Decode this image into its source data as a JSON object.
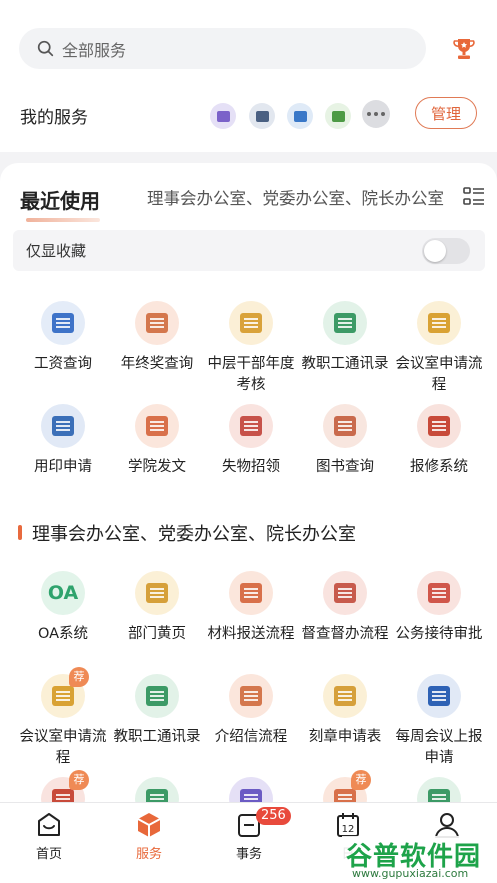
{
  "search": {
    "placeholder": "全部服务",
    "icon": "search-icon"
  },
  "header": {
    "trophy_icon": "trophy-icon"
  },
  "my_services": {
    "title": "我的服务",
    "manage_label": "管理",
    "mini_icons": [
      {
        "name": "id-card-icon",
        "bg": "#e5e0f6",
        "fg": "#7b62c9"
      },
      {
        "name": "chart-board-icon",
        "bg": "#e2e7ef",
        "fg": "#4a6082"
      },
      {
        "name": "monitor-icon",
        "bg": "#dfeaf7",
        "fg": "#3a78c8"
      },
      {
        "name": "clipboard-icon",
        "bg": "#e7f3e4",
        "fg": "#4d9a45"
      }
    ],
    "more_icon": "more-dots-icon"
  },
  "recent": {
    "title": "最近使用",
    "tab_other": "理事会办公室、党委办公室、院长办公室",
    "list_icon": "list-view-icon",
    "fav_only_label": "仅显收藏",
    "fav_only_on": false,
    "items": [
      {
        "label": "工资查询",
        "icon": "payroll-icon",
        "bg": "#e4ecf8",
        "fg": "#3e73c8"
      },
      {
        "label": "年终奖查询",
        "icon": "bonus-yen-icon",
        "bg": "#fbe6dc",
        "fg": "#d4774d"
      },
      {
        "label": "中层干部年度考核",
        "icon": "assessment-icon",
        "bg": "#fbefd6",
        "fg": "#d9a23a"
      },
      {
        "label": "教职工通讯录",
        "icon": "contacts-book-icon",
        "bg": "#e2f2e8",
        "fg": "#3c9a66"
      },
      {
        "label": "会议室申请流程",
        "icon": "meeting-room-icon",
        "bg": "#fbf0d6",
        "fg": "#d9a234"
      },
      {
        "label": "用印申请",
        "icon": "stamp-icon",
        "bg": "#e1e9f6",
        "fg": "#3b6fb8"
      },
      {
        "label": "学院发文",
        "icon": "document-icon",
        "bg": "#fbe6dc",
        "fg": "#d9704a"
      },
      {
        "label": "失物招领",
        "icon": "lost-found-icon",
        "bg": "#f9e3df",
        "fg": "#c7524a"
      },
      {
        "label": "图书查询",
        "icon": "book-search-icon",
        "bg": "#f8e6df",
        "fg": "#c96a4c"
      },
      {
        "label": "报修系统",
        "icon": "repair-house-icon",
        "bg": "#f8e2dd",
        "fg": "#c84a3a"
      }
    ]
  },
  "section": {
    "title": "理事会办公室、党委办公室、院长办公室",
    "items": [
      {
        "label": "OA系统",
        "icon": "oa-icon",
        "text": "OA",
        "bg": "#e2f4ea",
        "fg": "#2fa36d"
      },
      {
        "label": "部门黄页",
        "icon": "yellow-pages-icon",
        "bg": "#fbf0d6",
        "fg": "#d6a03a"
      },
      {
        "label": "材料报送流程",
        "icon": "folder-submit-icon",
        "bg": "#fbe6dc",
        "fg": "#d8704a"
      },
      {
        "label": "督查督办流程",
        "icon": "supervise-icon",
        "bg": "#f9e3df",
        "fg": "#c85a4c"
      },
      {
        "label": "公务接待审批",
        "icon": "reception-calendar-icon",
        "bg": "#f9e3df",
        "fg": "#d0564a"
      },
      {
        "label": "会议室申请流程",
        "icon": "meeting-room-icon",
        "bg": "#fbf0d6",
        "fg": "#d9a234",
        "badge": "荐"
      },
      {
        "label": "教职工通讯录",
        "icon": "contacts-book-icon",
        "bg": "#e2f2e8",
        "fg": "#3c9a66"
      },
      {
        "label": "介绍信流程",
        "icon": "letter-icon",
        "bg": "#fbe6dc",
        "fg": "#d4774d"
      },
      {
        "label": "刻章申请表",
        "icon": "seal-form-icon",
        "bg": "#fbf0d6",
        "fg": "#d6a03a"
      },
      {
        "label": "每周会议上报申请",
        "icon": "weekly-report-icon",
        "bg": "#e1e9f6",
        "fg": "#2e62b5"
      }
    ],
    "partial_items": [
      {
        "icon": "briefcase-icon",
        "bg": "#f9e3df",
        "fg": "#c84a3a",
        "badge": "荐"
      },
      {
        "icon": "speaker-icon",
        "bg": "#e2f2e8",
        "fg": "#3c9a66"
      },
      {
        "icon": "clock-icon",
        "bg": "#e5e0f6",
        "fg": "#6b5bc4"
      },
      {
        "icon": "checklist-icon",
        "bg": "#fbe6dc",
        "fg": "#d8704a",
        "badge": "荐"
      },
      {
        "icon": "table-icon",
        "bg": "#e2f2e8",
        "fg": "#3c9a66"
      }
    ]
  },
  "tabbar": {
    "tabs": [
      {
        "label": "首页",
        "icon": "home-icon"
      },
      {
        "label": "服务",
        "icon": "service-box-icon",
        "active": true
      },
      {
        "label": "事务",
        "icon": "tasks-icon",
        "badge": "256"
      },
      {
        "label": "日",
        "icon": "calendar-icon"
      },
      {
        "label": "",
        "icon": "profile-icon"
      }
    ]
  },
  "watermark": {
    "title": "谷普软件园",
    "url": "www.gupuxiazai.com"
  },
  "colors": {
    "accent": "#e8683a",
    "badge_red": "#e84a3c"
  }
}
